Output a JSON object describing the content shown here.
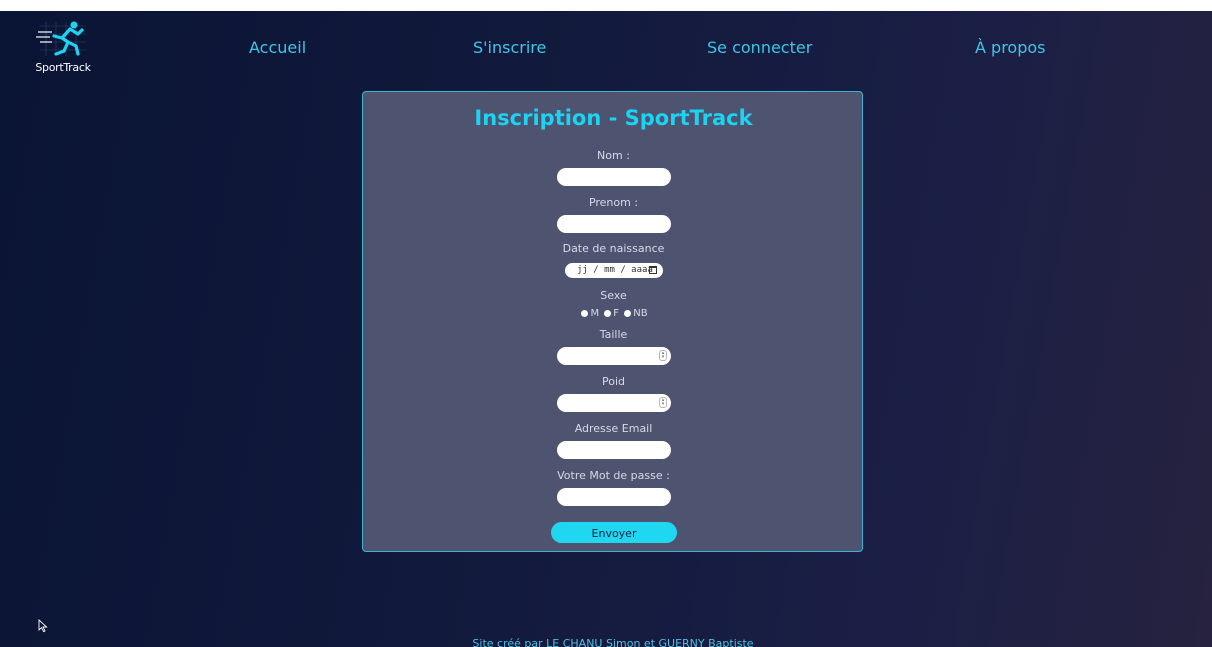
{
  "brand": {
    "logo_text": "SportTrack",
    "accent_color": "#1bd3f2"
  },
  "nav": {
    "items": [
      {
        "label": "Accueil"
      },
      {
        "label": "S'inscrire"
      },
      {
        "label": "Se connecter"
      },
      {
        "label": "À propos"
      }
    ]
  },
  "form": {
    "title": "Inscription - SportTrack",
    "fields": {
      "nom": {
        "label": "Nom :",
        "value": ""
      },
      "prenom": {
        "label": "Prenom :",
        "value": ""
      },
      "naissance": {
        "label": "Date de naissance",
        "placeholder": "jj / mm / aaaa"
      },
      "sexe": {
        "label": "Sexe",
        "options": [
          "M",
          "F",
          "NB"
        ]
      },
      "taille": {
        "label": "Taille",
        "value": ""
      },
      "poid": {
        "label": "Poid",
        "value": ""
      },
      "email": {
        "label": "Adresse Email",
        "value": ""
      },
      "password": {
        "label": "Votre Mot de passe :",
        "value": ""
      }
    },
    "submit_label": "Envoyer"
  },
  "footer": {
    "credit": "Site créé par LE CHANU Simon et GUERNY Baptiste"
  },
  "icons": {
    "logo": "runner-icon",
    "calendar": "calendar-icon",
    "cursor": "mouse-pointer-icon"
  }
}
